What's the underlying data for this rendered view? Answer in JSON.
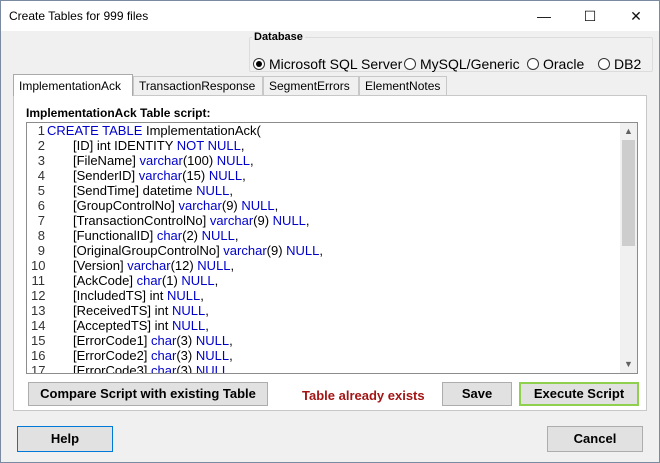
{
  "window": {
    "title": "Create Tables for 999 files",
    "minimize_glyph": "—",
    "maximize_glyph": "☐",
    "close_glyph": "✕"
  },
  "database": {
    "legend": "Database",
    "options": [
      "Microsoft SQL Server",
      "MySQL/Generic",
      "Oracle",
      "DB2"
    ],
    "selected": "Microsoft SQL Server"
  },
  "tabs": [
    "ImplementationAck",
    "TransactionResponse",
    "SegmentErrors",
    "ElementNotes"
  ],
  "active_tab": "ImplementationAck",
  "panel": {
    "label": "ImplementationAck Table script:"
  },
  "script_lines": [
    {
      "n": "1",
      "parts": [
        {
          "t": "CREATE TABLE ",
          "k": true
        },
        {
          "t": "ImplementationAck(",
          "k": false
        }
      ],
      "indent": false
    },
    {
      "n": "2",
      "parts": [
        {
          "t": "[ID] int IDENTITY ",
          "k": false
        },
        {
          "t": "NOT NULL",
          "k": true
        },
        {
          "t": ",",
          "k": false
        }
      ],
      "indent": true
    },
    {
      "n": "3",
      "parts": [
        {
          "t": "[FileName] ",
          "k": false
        },
        {
          "t": "varchar",
          "k": true
        },
        {
          "t": "(100) ",
          "k": false
        },
        {
          "t": "NULL",
          "k": true
        },
        {
          "t": ",",
          "k": false
        }
      ],
      "indent": true
    },
    {
      "n": "4",
      "parts": [
        {
          "t": "[SenderID] ",
          "k": false
        },
        {
          "t": "varchar",
          "k": true
        },
        {
          "t": "(15) ",
          "k": false
        },
        {
          "t": "NULL",
          "k": true
        },
        {
          "t": ",",
          "k": false
        }
      ],
      "indent": true
    },
    {
      "n": "5",
      "parts": [
        {
          "t": "[SendTime] datetime ",
          "k": false
        },
        {
          "t": "NULL",
          "k": true
        },
        {
          "t": ",",
          "k": false
        }
      ],
      "indent": true
    },
    {
      "n": "6",
      "parts": [
        {
          "t": "[GroupControlNo] ",
          "k": false
        },
        {
          "t": "varchar",
          "k": true
        },
        {
          "t": "(9) ",
          "k": false
        },
        {
          "t": "NULL",
          "k": true
        },
        {
          "t": ",",
          "k": false
        }
      ],
      "indent": true
    },
    {
      "n": "7",
      "parts": [
        {
          "t": "[TransactionControlNo] ",
          "k": false
        },
        {
          "t": "varchar",
          "k": true
        },
        {
          "t": "(9) ",
          "k": false
        },
        {
          "t": "NULL",
          "k": true
        },
        {
          "t": ",",
          "k": false
        }
      ],
      "indent": true
    },
    {
      "n": "8",
      "parts": [
        {
          "t": "[FunctionalID] ",
          "k": false
        },
        {
          "t": "char",
          "k": true
        },
        {
          "t": "(2) ",
          "k": false
        },
        {
          "t": "NULL",
          "k": true
        },
        {
          "t": ",",
          "k": false
        }
      ],
      "indent": true
    },
    {
      "n": "9",
      "parts": [
        {
          "t": "[OriginalGroupControlNo] ",
          "k": false
        },
        {
          "t": "varchar",
          "k": true
        },
        {
          "t": "(9) ",
          "k": false
        },
        {
          "t": "NULL",
          "k": true
        },
        {
          "t": ",",
          "k": false
        }
      ],
      "indent": true
    },
    {
      "n": "10",
      "parts": [
        {
          "t": "[Version] ",
          "k": false
        },
        {
          "t": "varchar",
          "k": true
        },
        {
          "t": "(12) ",
          "k": false
        },
        {
          "t": "NULL",
          "k": true
        },
        {
          "t": ",",
          "k": false
        }
      ],
      "indent": true
    },
    {
      "n": "11",
      "parts": [
        {
          "t": "[AckCode] ",
          "k": false
        },
        {
          "t": "char",
          "k": true
        },
        {
          "t": "(1) ",
          "k": false
        },
        {
          "t": "NULL",
          "k": true
        },
        {
          "t": ",",
          "k": false
        }
      ],
      "indent": true
    },
    {
      "n": "12",
      "parts": [
        {
          "t": "[IncludedTS] int ",
          "k": false
        },
        {
          "t": "NULL",
          "k": true
        },
        {
          "t": ",",
          "k": false
        }
      ],
      "indent": true
    },
    {
      "n": "13",
      "parts": [
        {
          "t": "[ReceivedTS] int ",
          "k": false
        },
        {
          "t": "NULL",
          "k": true
        },
        {
          "t": ",",
          "k": false
        }
      ],
      "indent": true
    },
    {
      "n": "14",
      "parts": [
        {
          "t": "[AcceptedTS] int ",
          "k": false
        },
        {
          "t": "NULL",
          "k": true
        },
        {
          "t": ",",
          "k": false
        }
      ],
      "indent": true
    },
    {
      "n": "15",
      "parts": [
        {
          "t": "[ErrorCode1] ",
          "k": false
        },
        {
          "t": "char",
          "k": true
        },
        {
          "t": "(3) ",
          "k": false
        },
        {
          "t": "NULL",
          "k": true
        },
        {
          "t": ",",
          "k": false
        }
      ],
      "indent": true
    },
    {
      "n": "16",
      "parts": [
        {
          "t": "[ErrorCode2] ",
          "k": false
        },
        {
          "t": "char",
          "k": true
        },
        {
          "t": "(3) ",
          "k": false
        },
        {
          "t": "NULL",
          "k": true
        },
        {
          "t": ",",
          "k": false
        }
      ],
      "indent": true
    },
    {
      "n": "17",
      "parts": [
        {
          "t": "[ErrorCode3] ",
          "k": false
        },
        {
          "t": "char",
          "k": true
        },
        {
          "t": "(3) ",
          "k": false
        },
        {
          "t": "NULL",
          "k": true
        },
        {
          "t": ",",
          "k": false
        }
      ],
      "indent": true
    }
  ],
  "scroll": {
    "up_glyph": "▲",
    "down_glyph": "▼"
  },
  "actions": {
    "compare": "Compare Script with existing Table",
    "status": "Table already exists",
    "save": "Save",
    "execute": "Execute Script"
  },
  "footer": {
    "help": "Help",
    "cancel": "Cancel"
  },
  "colors": {
    "keyword": "#0000cc",
    "status": "#a31515",
    "execute_border": "#8fd14f",
    "help_border": "#0078d7"
  }
}
